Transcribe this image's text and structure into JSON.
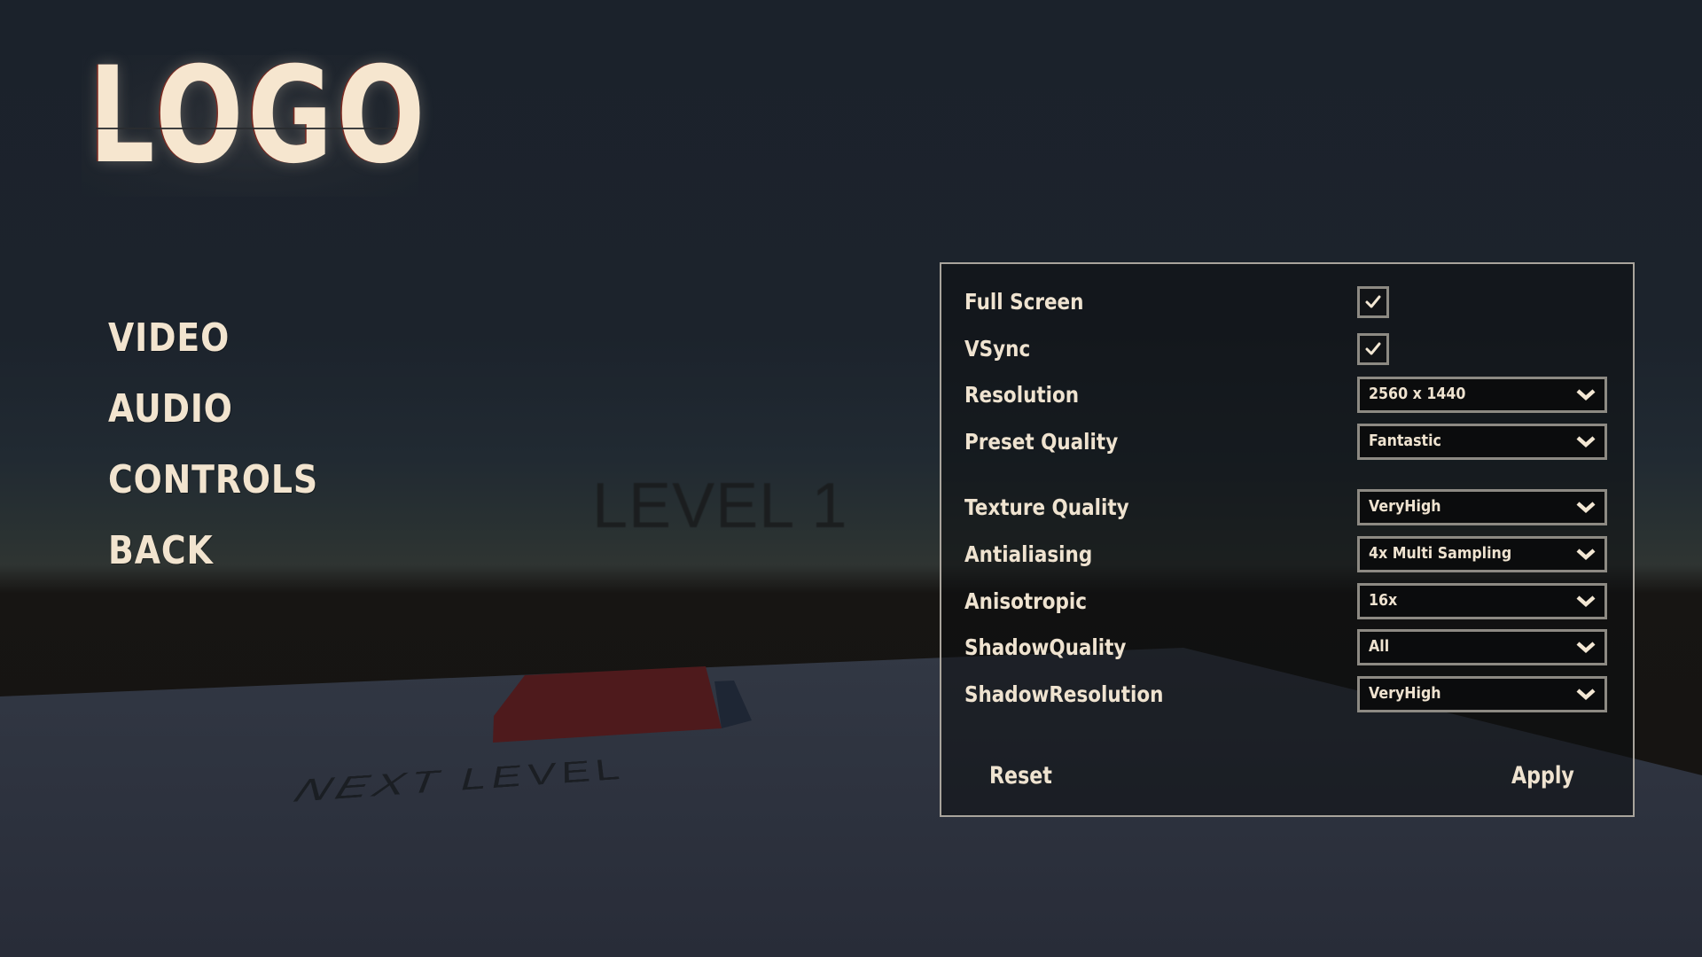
{
  "scene": {
    "level_title": "LEVEL 1",
    "floor_text": "NEXT LEVEL",
    "colors": {
      "block": "#4e1a1c",
      "block_shadow": "#1e2634",
      "ground": "#2c313c"
    }
  },
  "logo": {
    "text": "LOGO"
  },
  "menu": {
    "items": [
      {
        "label": "VIDEO"
      },
      {
        "label": "AUDIO"
      },
      {
        "label": "CONTROLS"
      },
      {
        "label": "BACK"
      }
    ]
  },
  "settings": {
    "toggles": [
      {
        "label": "Full Screen",
        "checked": true,
        "icon": "checkmark-icon"
      },
      {
        "label": "VSync",
        "checked": true,
        "icon": "checkmark-icon"
      }
    ],
    "dropdowns": [
      {
        "label": "Resolution",
        "value": "2560 x 1440"
      },
      {
        "label": "Preset Quality",
        "value": "Fantastic"
      },
      {
        "label": "Texture Quality",
        "value": "VeryHigh"
      },
      {
        "label": "Antialiasing",
        "value": "4x Multi Sampling"
      },
      {
        "label": "Anisotropic",
        "value": "16x"
      },
      {
        "label": "ShadowQuality",
        "value": "All"
      },
      {
        "label": "ShadowResolution",
        "value": "VeryHigh"
      }
    ],
    "reset_label": "Reset",
    "apply_label": "Apply",
    "colors": {
      "text": "#efe3d0",
      "border": "#8d8a83",
      "panel_border": "#a9a49c"
    }
  }
}
